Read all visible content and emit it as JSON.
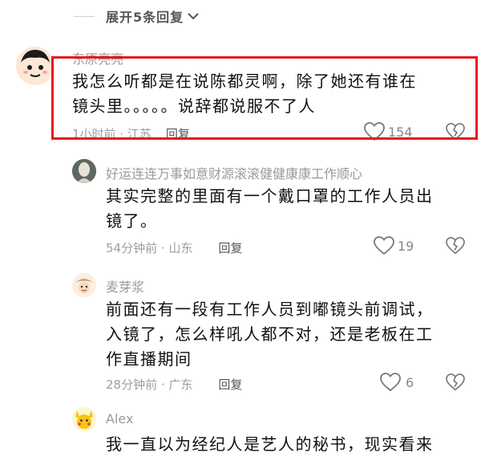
{
  "expand": {
    "label": "展开5条回复"
  },
  "main_comment": {
    "username": "东原亮亮",
    "text_line1": "我怎么听都是在说陈都灵啊，除了她还有谁在",
    "text_line2": "镜头里。。。。。说辞都说服不了人",
    "time_location": "1小时前 · 江苏",
    "reply_label": "回复",
    "likes": "154"
  },
  "replies": [
    {
      "username": "好运连连万事如意财源滚滚健健康康工作顺心",
      "text_line1": "其实完整的里面有一个戴口罩的工作人员出",
      "text_line2": "镜了。",
      "time_location": "54分钟前 · 山东",
      "reply_label": "回复",
      "likes": "19"
    },
    {
      "username": "麦芽浆",
      "text_line1": "前面还有一段有工作人员到嘟镜头前调试，",
      "text_line2": "入镜了，怎么样吼人都不对，还是老板在工",
      "text_line3": "作直播期间",
      "time_location": "28分钟前 · 广东",
      "reply_label": "回复",
      "likes": "6"
    },
    {
      "username": "Alex",
      "text_line1": "我一直以为经纪人是艺人的秘书，现实看来"
    }
  ],
  "colors": {
    "highlight": "#e6191f",
    "muted_text": "#9e9e9e",
    "body_text": "#111111"
  }
}
